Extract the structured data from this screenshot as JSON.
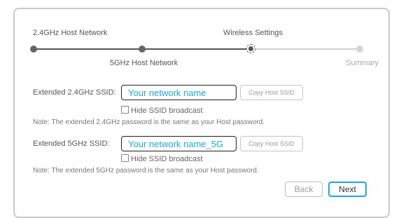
{
  "stepper": {
    "steps": [
      {
        "label": "2.4GHz Host Network",
        "state": "done"
      },
      {
        "label": "5GHz Host Network",
        "state": "done"
      },
      {
        "label": "Wireless Settings",
        "state": "current"
      },
      {
        "label": "Summary",
        "state": "upcoming"
      }
    ]
  },
  "band24": {
    "ssid_label": "Extended 2.4GHz SSID:",
    "ssid_value": "Your network name",
    "copy_label": "Copy Host SSID",
    "hide_label": "Hide SSID broadcast",
    "hide_checked": false,
    "note": "Note: The extended 2.4GHz password is the same as your Host password."
  },
  "band5": {
    "ssid_label": "Extended 5GHz SSID:",
    "ssid_value": "Your network name_5G",
    "copy_label": "Copy Host SSID",
    "hide_label": "Hide SSID broadcast",
    "hide_checked": false,
    "note": "Note: The extended 5GHz password is the same as your Host password."
  },
  "actions": {
    "back_label": "Back",
    "next_label": "Next"
  },
  "colors": {
    "accent": "#1aa7e0",
    "text": "#555555",
    "border": "#c9c9c9",
    "inactive": "#cfcfcf"
  }
}
